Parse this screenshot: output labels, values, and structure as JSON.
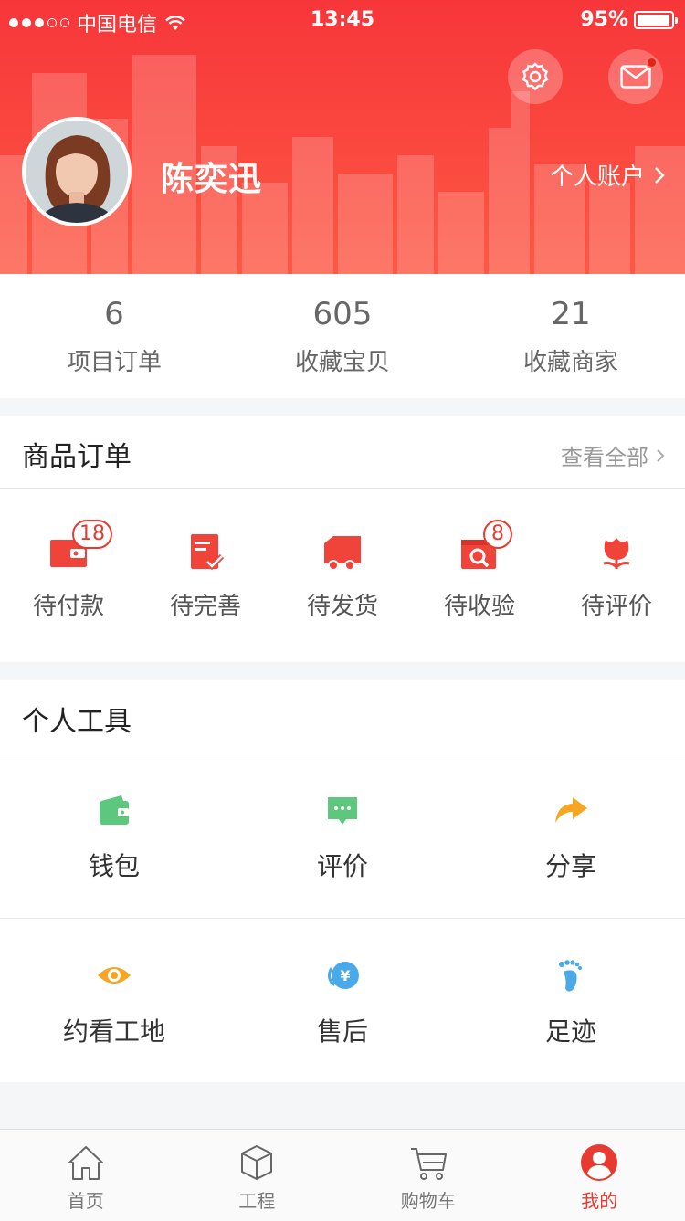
{
  "status_bar": {
    "carrier": "中国电信",
    "time": "13:45",
    "battery": "95%"
  },
  "header": {
    "username": "陈奕迅",
    "account_link": "个人账户"
  },
  "stats": [
    {
      "value": "6",
      "label": "项目订单"
    },
    {
      "value": "605",
      "label": "收藏宝贝"
    },
    {
      "value": "21",
      "label": "收藏商家"
    }
  ],
  "orders": {
    "title": "商品订单",
    "more": "查看全部",
    "items": [
      {
        "label": "待付款",
        "badge": "18",
        "icon": "wallet-icon"
      },
      {
        "label": "待完善",
        "badge": "",
        "icon": "document-check-icon"
      },
      {
        "label": "待发货",
        "badge": "",
        "icon": "truck-icon"
      },
      {
        "label": "待收验",
        "badge": "8",
        "icon": "box-search-icon"
      },
      {
        "label": "待评价",
        "badge": "",
        "icon": "flower-icon"
      }
    ]
  },
  "tools": {
    "title": "个人工具",
    "items": [
      {
        "label": "钱包",
        "icon": "wallet-icon",
        "color": "#5cc77d"
      },
      {
        "label": "评价",
        "icon": "chat-bubble-icon",
        "color": "#5cc77d"
      },
      {
        "label": "分享",
        "icon": "share-arrow-icon",
        "color": "#f5a623"
      },
      {
        "label": "约看工地",
        "icon": "eye-icon",
        "color": "#f5a623"
      },
      {
        "label": "售后",
        "icon": "yuan-refund-icon",
        "color": "#4aa9e9"
      },
      {
        "label": "足迹",
        "icon": "footprint-icon",
        "color": "#4aa9e9"
      }
    ]
  },
  "tabbar": [
    {
      "label": "首页",
      "icon": "home-icon",
      "active": false
    },
    {
      "label": "工程",
      "icon": "cube-icon",
      "active": false
    },
    {
      "label": "购物车",
      "icon": "cart-icon",
      "active": false
    },
    {
      "label": "我的",
      "icon": "user-icon",
      "active": true
    }
  ],
  "colors": {
    "brand_red": "#f7363a",
    "active_tab": "#e83a30"
  }
}
